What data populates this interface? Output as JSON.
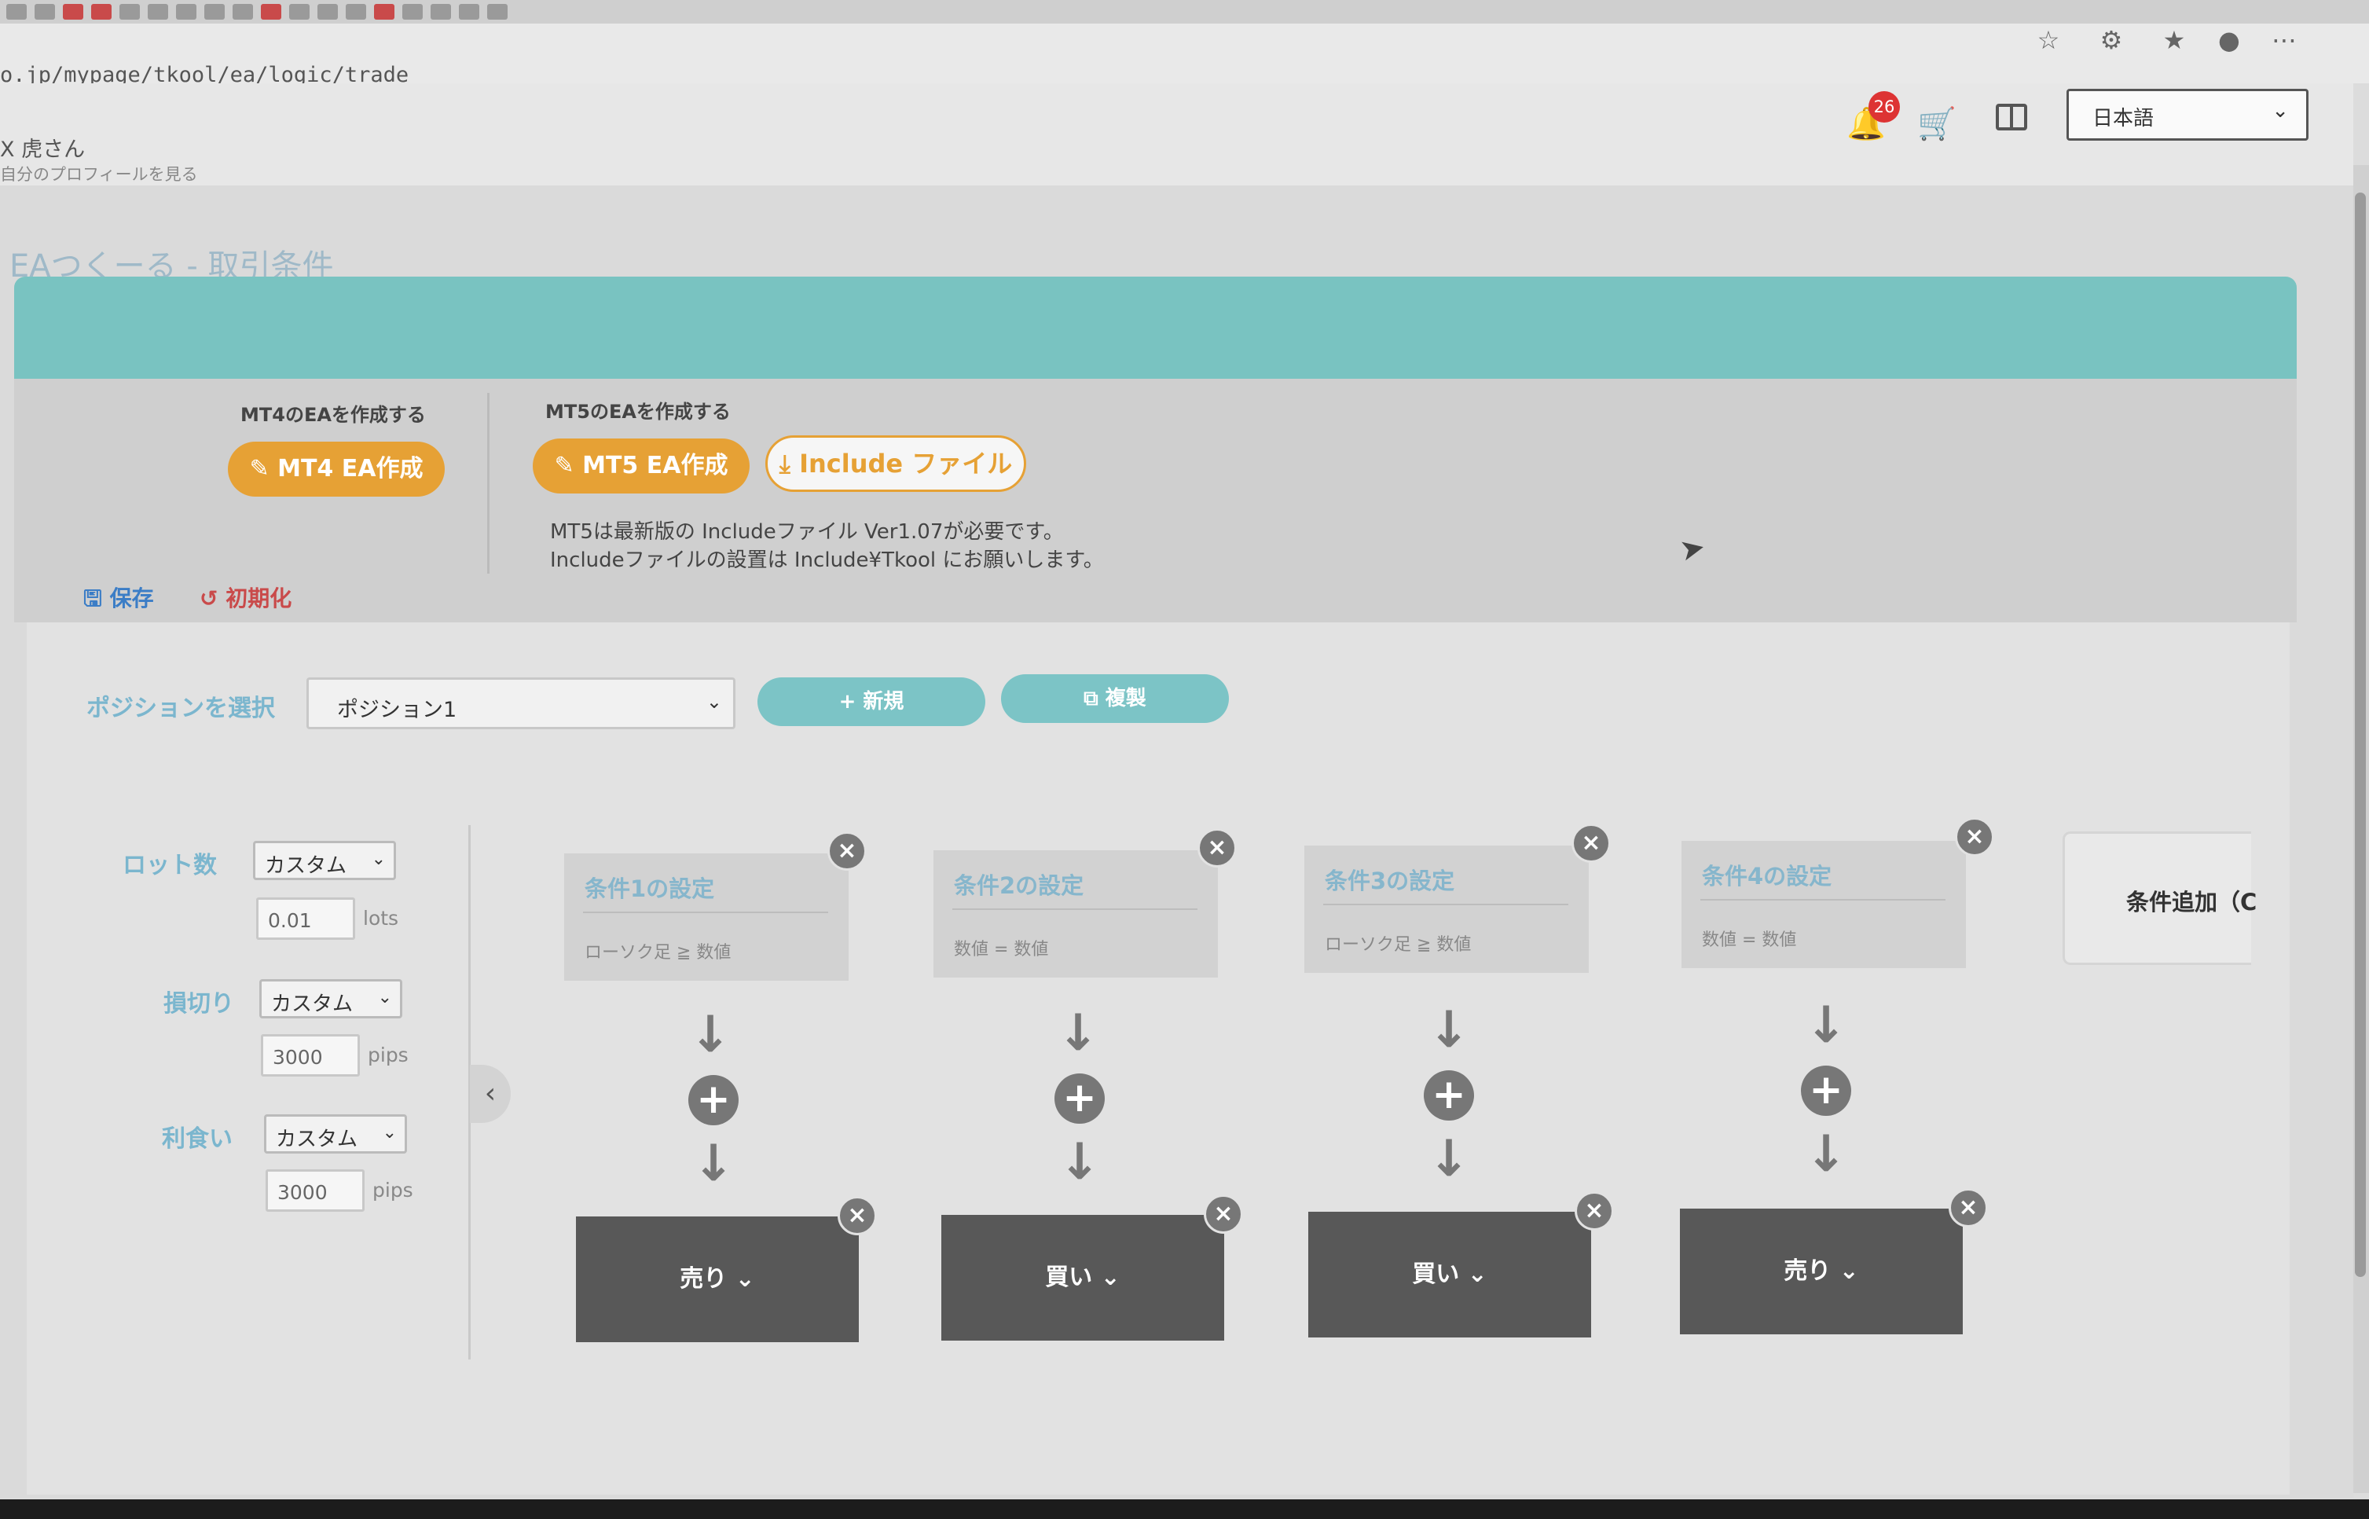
{
  "browser": {
    "address": "o.jp/mypage/tkool/ea/logic/trade"
  },
  "header": {
    "username": "X 虎さん",
    "profile_link": "自分のプロフィールを見る",
    "notification_count": "26",
    "language": "日本語"
  },
  "page": {
    "title": "EAつくーる - 取引条件"
  },
  "create": {
    "mt4_label": "MT4のEAを作成する",
    "mt4_button": "MT4 EA作成",
    "mt5_label": "MT5のEAを作成する",
    "mt5_button": "MT5 EA作成",
    "include_button": "Include ファイル",
    "note_line1": "MT5は最新版の Includeファイル Ver1.07が必要です。",
    "note_line2": "Includeファイルの設置は Include¥Tkool にお願いします。",
    "save_label": "保存",
    "reset_label": "初期化"
  },
  "position": {
    "label": "ポジションを選択",
    "selected": "ポジション1",
    "new_button": "新規",
    "copy_button": "複製"
  },
  "settings": {
    "lot": {
      "label": "ロット数",
      "mode": "カスタム",
      "value": "0.01",
      "unit": "lots"
    },
    "stoploss": {
      "label": "損切り",
      "mode": "カスタム",
      "value": "3000",
      "unit": "pips"
    },
    "takeprofit": {
      "label": "利食い",
      "mode": "カスタム",
      "value": "3000",
      "unit": "pips"
    }
  },
  "conditions": [
    {
      "title": "条件1の設定",
      "summary": "ローソク足 ≧ 数値",
      "action": "売り"
    },
    {
      "title": "条件2の設定",
      "summary": "数値 = 数値",
      "action": "買い"
    },
    {
      "title": "条件3の設定",
      "summary": "ローソク足 ≧ 数値",
      "action": "買い"
    },
    {
      "title": "条件4の設定",
      "summary": "数値 = 数値",
      "action": "売り"
    }
  ],
  "add_condition": "条件追加（C",
  "icons": {
    "close": "close-icon",
    "plus": "plus-icon",
    "arrow": "arrow-down-icon",
    "chevron": "chevron-down-icon"
  },
  "colors": {
    "accent_orange": "#e6a135",
    "teal": "#79c3c1",
    "label_blue": "#7bb6ce",
    "action_dark": "#585858"
  }
}
